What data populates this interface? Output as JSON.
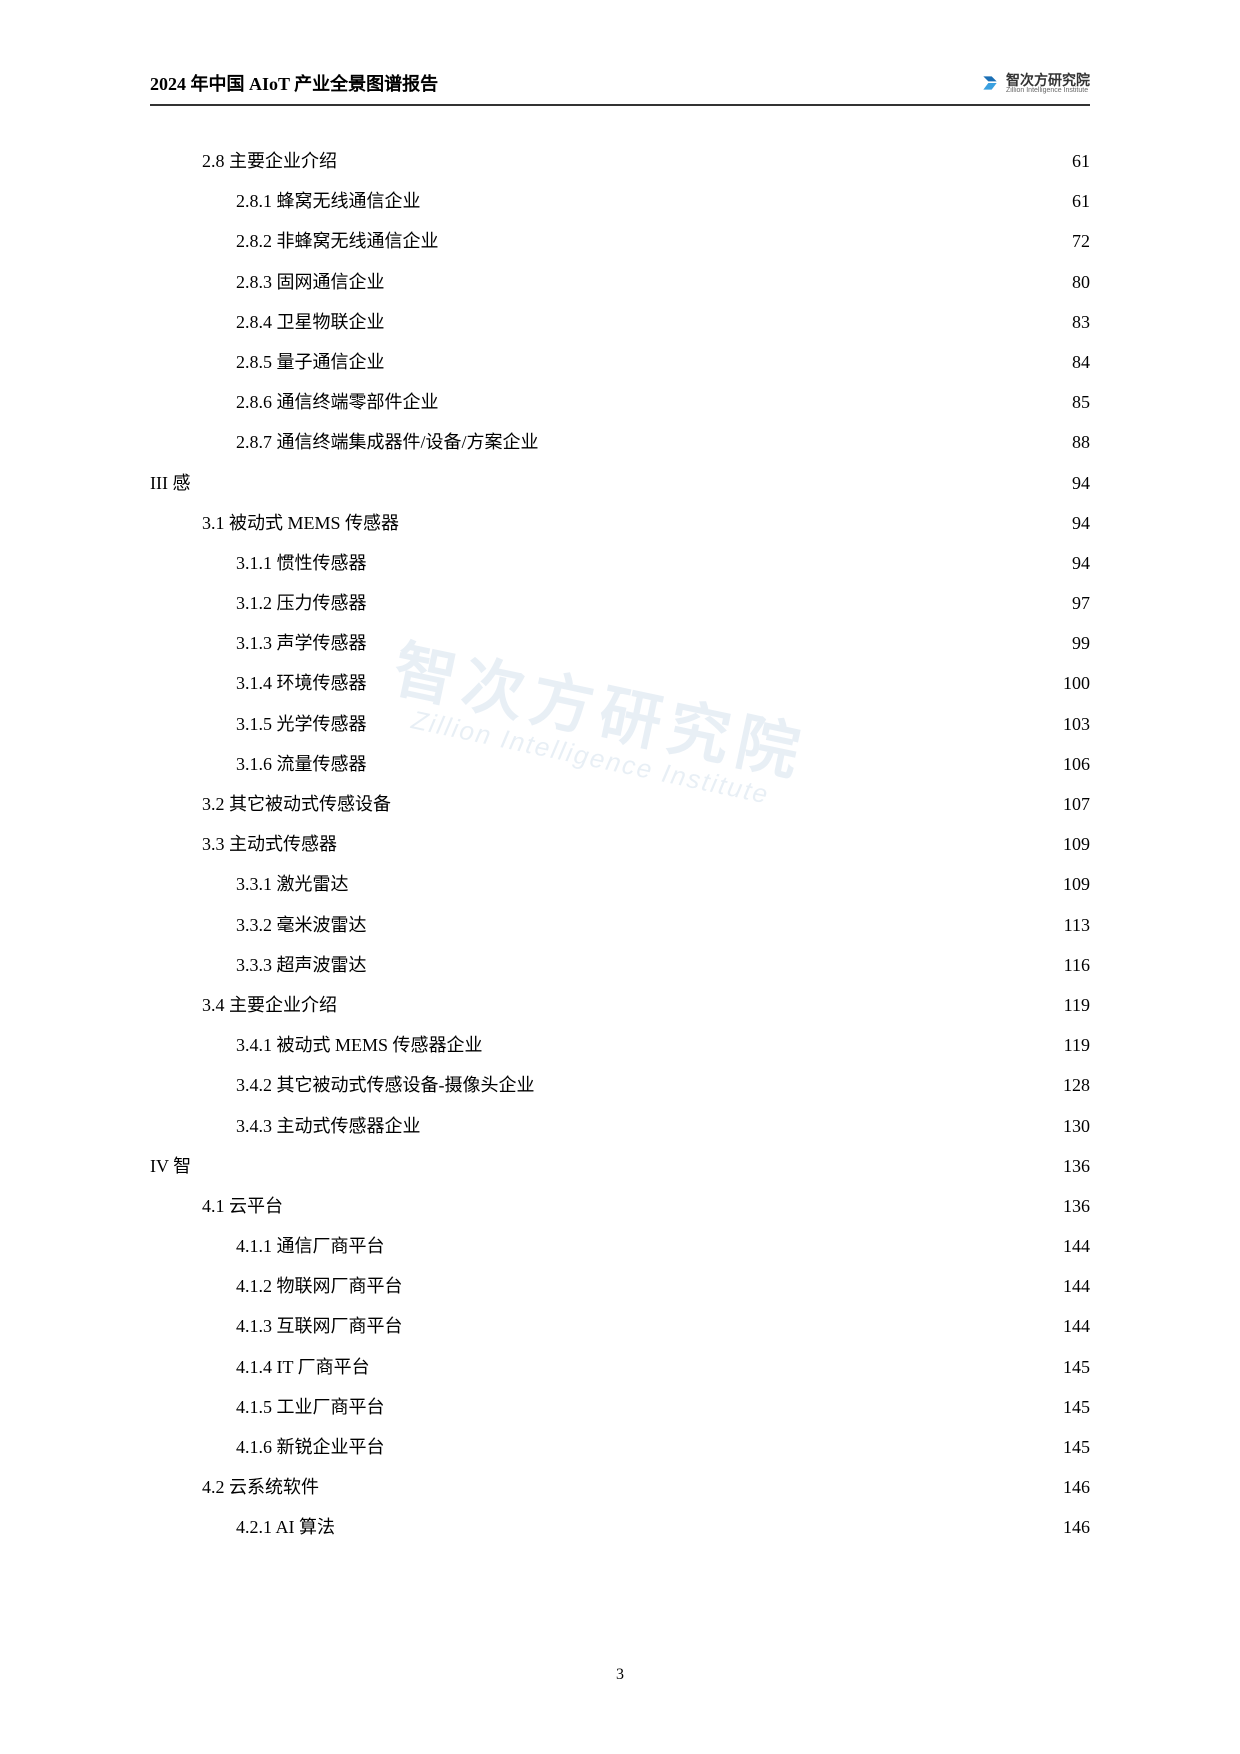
{
  "header": {
    "title": "2024 年中国 AIoT 产业全景图谱报告",
    "logo_cn": "智次方研究院",
    "logo_en": "Zillion Intelligence Institute"
  },
  "watermark": {
    "cn": "智次方研究院",
    "en": "Zillion Intelligence Institute"
  },
  "page_number": "3",
  "toc": [
    {
      "level": 1,
      "title": "2.8 主要企业介绍",
      "page": "61"
    },
    {
      "level": 2,
      "title": "2.8.1 蜂窝无线通信企业",
      "page": "61"
    },
    {
      "level": 2,
      "title": "2.8.2 非蜂窝无线通信企业",
      "page": "72"
    },
    {
      "level": 2,
      "title": "2.8.3 固网通信企业",
      "page": "80"
    },
    {
      "level": 2,
      "title": "2.8.4 卫星物联企业",
      "page": "83"
    },
    {
      "level": 2,
      "title": "2.8.5 量子通信企业",
      "page": "84"
    },
    {
      "level": 2,
      "title": "2.8.6 通信终端零部件企业",
      "page": "85"
    },
    {
      "level": 2,
      "title": "2.8.7 通信终端集成器件/设备/方案企业",
      "page": "88"
    },
    {
      "level": 0,
      "title": "III 感",
      "page": "94"
    },
    {
      "level": 1,
      "title": "3.1 被动式 MEMS 传感器",
      "page": "94"
    },
    {
      "level": 2,
      "title": "3.1.1 惯性传感器",
      "page": "94"
    },
    {
      "level": 2,
      "title": "3.1.2 压力传感器",
      "page": "97"
    },
    {
      "level": 2,
      "title": "3.1.3 声学传感器",
      "page": "99"
    },
    {
      "level": 2,
      "title": "3.1.4 环境传感器",
      "page": "100"
    },
    {
      "level": 2,
      "title": "3.1.5 光学传感器",
      "page": "103"
    },
    {
      "level": 2,
      "title": "3.1.6 流量传感器",
      "page": "106"
    },
    {
      "level": 1,
      "title": "3.2 其它被动式传感设备",
      "page": "107"
    },
    {
      "level": 1,
      "title": "3.3 主动式传感器",
      "page": "109"
    },
    {
      "level": 2,
      "title": "3.3.1 激光雷达",
      "page": "109"
    },
    {
      "level": 2,
      "title": "3.3.2 毫米波雷达",
      "page": "113"
    },
    {
      "level": 2,
      "title": "3.3.3 超声波雷达",
      "page": "116"
    },
    {
      "level": 1,
      "title": "3.4 主要企业介绍",
      "page": "119"
    },
    {
      "level": 2,
      "title": "3.4.1 被动式 MEMS 传感器企业",
      "page": "119"
    },
    {
      "level": 2,
      "title": "3.4.2 其它被动式传感设备-摄像头企业",
      "page": "128"
    },
    {
      "level": 2,
      "title": "3.4.3 主动式传感器企业",
      "page": "130"
    },
    {
      "level": 0,
      "title": "IV 智",
      "page": "136"
    },
    {
      "level": 1,
      "title": "4.1 云平台",
      "page": "136"
    },
    {
      "level": 2,
      "title": "4.1.1 通信厂商平台",
      "page": "144"
    },
    {
      "level": 2,
      "title": "4.1.2 物联网厂商平台",
      "page": "144"
    },
    {
      "level": 2,
      "title": "4.1.3 互联网厂商平台",
      "page": "144"
    },
    {
      "level": 2,
      "title": "4.1.4 IT 厂商平台",
      "page": "145"
    },
    {
      "level": 2,
      "title": "4.1.5 工业厂商平台",
      "page": "145"
    },
    {
      "level": 2,
      "title": "4.1.6 新锐企业平台",
      "page": "145"
    },
    {
      "level": 1,
      "title": "4.2 云系统软件",
      "page": "146"
    },
    {
      "level": 2,
      "title": "4.2.1 AI 算法",
      "page": "146"
    }
  ]
}
